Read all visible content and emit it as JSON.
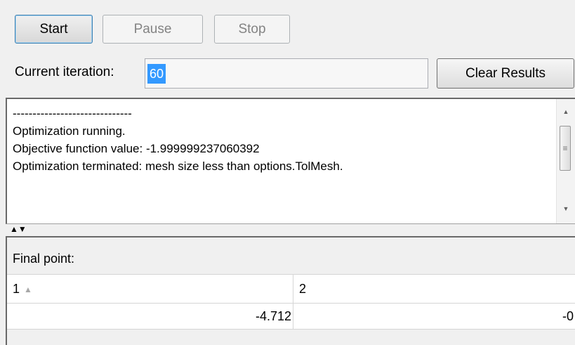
{
  "toolbar": {
    "start_label": "Start",
    "pause_label": "Pause",
    "stop_label": "Stop",
    "clear_label": "Clear Results"
  },
  "iteration": {
    "label": "Current iteration:",
    "value": "60"
  },
  "log": {
    "lines": [
      "------------------------------",
      "Optimization running.",
      "Objective function value: -1.999999237060392",
      "Optimization terminated: mesh size less than options.TolMesh."
    ]
  },
  "final_point": {
    "title": "Final point:",
    "columns": [
      "1",
      "2"
    ],
    "rows": [
      [
        "-4.712",
        "-0"
      ]
    ]
  },
  "icons": {
    "sort": "sort-ascending-icon",
    "scroll_up": "scroll-up-icon",
    "scroll_down": "scroll-down-icon",
    "splitter": "splitter-arrows-icon"
  },
  "colors": {
    "selection": "#3399ff",
    "default_button_border": "#3c7fb1"
  }
}
